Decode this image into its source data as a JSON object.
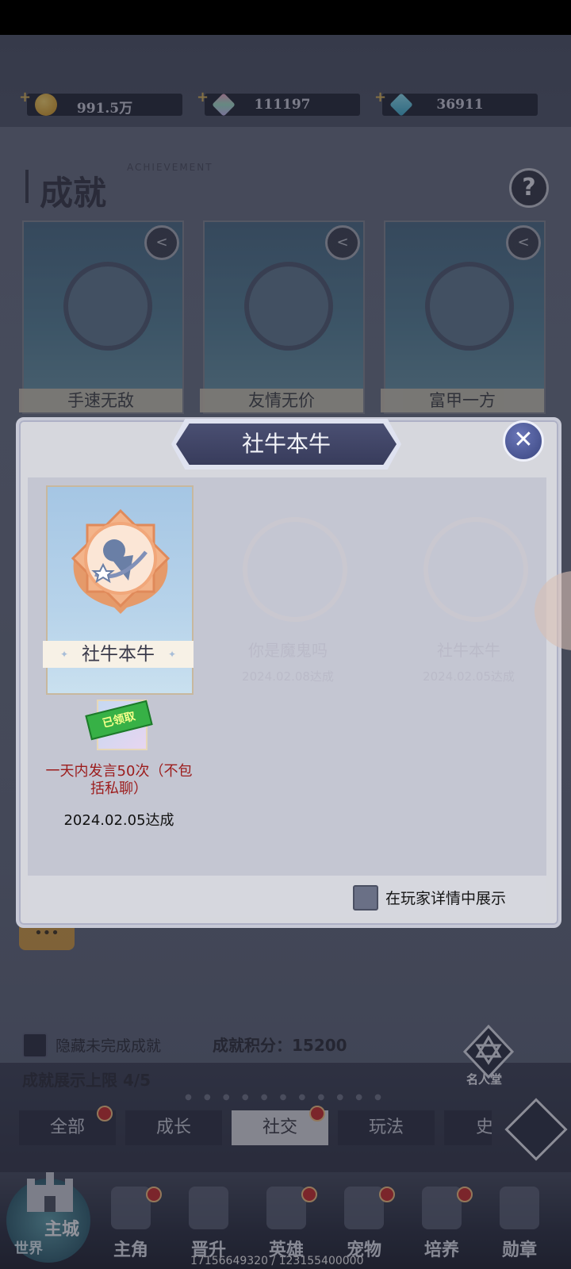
{
  "currency": [
    {
      "icon": "gold-coin-icon",
      "value": "991.5万"
    },
    {
      "icon": "rainbow-crystal-icon",
      "value": "111197"
    },
    {
      "icon": "blue-diamond-icon",
      "value": "36911"
    }
  ],
  "header": {
    "title": "成就",
    "subtitle": "ACHIEVEMENT"
  },
  "cards": [
    {
      "label": "手速无敌"
    },
    {
      "label": "友情无价"
    },
    {
      "label": "富甲一方"
    }
  ],
  "modal": {
    "title": "社牛本牛",
    "achievement": {
      "label": "社牛本牛",
      "stamp": "已领取",
      "description": "一天内发言50次（不包括私聊）",
      "date": "2024.02.05达成"
    },
    "ghost_cards": [
      {
        "label": "你是魔鬼吗",
        "date": "2024.02.08达成"
      },
      {
        "label": "社牛本牛",
        "date": "2024.02.05达成"
      }
    ],
    "show_in_profile": "在玩家详情中展示"
  },
  "bottom_controls": {
    "hide_incomplete": "隐藏未完成成就",
    "score": "成就积分：15200",
    "limit": "成就展示上限 4/5",
    "hall": "名人堂"
  },
  "tabs": [
    {
      "label": "全部",
      "badge": true
    },
    {
      "label": "成长",
      "badge": false
    },
    {
      "label": "社交",
      "badge": true,
      "active": true
    },
    {
      "label": "玩法",
      "badge": false
    },
    {
      "label": "史",
      "badge": false
    }
  ],
  "nav": {
    "world_main": "主城",
    "world_sub": "世界",
    "items": [
      {
        "label": "主角",
        "badge": true
      },
      {
        "label": "晋升",
        "badge": false
      },
      {
        "label": "英雄",
        "badge": true
      },
      {
        "label": "宠物",
        "badge": true
      },
      {
        "label": "培养",
        "badge": true
      },
      {
        "label": "勋章",
        "badge": false
      }
    ]
  },
  "debug_coords": "17156649320 / 123155400000"
}
